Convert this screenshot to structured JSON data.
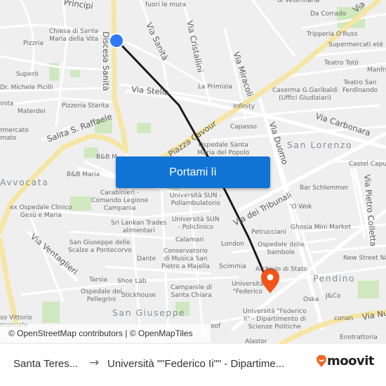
{
  "map": {
    "labels": {
      "principi": "Principi",
      "fuori_le_mura": "fuori le mura",
      "veterinaria": "di Veterinaria",
      "chiesa": "Chiesa di Santa\nMaria della Vita",
      "pizzeria": "Pizzria",
      "supero": "Superò",
      "picilli": "Dr. Michele Picilli",
      "costa": "osta",
      "materdei": "Materdei",
      "pizzeria_starita": "Pizzeria Starita",
      "supermercato": "rmercato\nmato",
      "da_corrado": "Da Corrado",
      "tripperia": "Tripperia O'Russ",
      "supermercati_ete": "Supermercati eté",
      "teatro_toto": "Teatro Totò",
      "manfredi": "Manfre",
      "teatro_san_ferdinando": "Teatro San\nFerdinando",
      "caserma": "Caserma G.Garibaldi\n(Uffici Giudiziari)",
      "la_primizia": "La Primizia",
      "infinity": "Infinity",
      "capasso": "Capasso",
      "ospedale_santa_maria": "Ospedale Santa\nMaria del Popolo",
      "bb_m": "B&B M",
      "bb_maria": "B&B Maria",
      "carabinieri": "Carabinieri -\nComando Legione\nCampania",
      "ex_ospedale": "ex Ospedale Clinico\nGesù e Maria",
      "sri_lankan": "Sri Lankan Trades\nalimentari",
      "univ_sun_poli": "Università SUN -\nPoliambulatorio",
      "univ_sun_policlinico": "Università SUN\n- Policlinico",
      "calamari": "Calamari",
      "castel_capuano": "Castel Capua",
      "bar_schlemmer": "Bar Schlemmer",
      "o_wok": "'O Wok",
      "ghosia": "Ghosia Mini Market",
      "petrucciani": "Petrucciani",
      "london": "London",
      "ospedale_bambole": "Ospedale delle\nbambole",
      "new_street": "New Street Nap",
      "archivio": "Archivio di Stato",
      "scimmia": "Scimmia",
      "univ_federico_short": "Università\n\"Federico",
      "univ_federico": "Università \"Federico\nII\" - Dipartimento di\nScienze Politiche",
      "oska": "Oska",
      "jco": "J&Co",
      "conan": "conan",
      "enotrattoria": "Enotrattoria",
      "alastor": "Alastor",
      "oof": "oof",
      "san_giuseppe_scalze": "San Giuseppe delle\nScalze a Pontecorvo",
      "dante": "Dante",
      "conservatorio": "Conservatorio\ndi Musica San\nPietro a Majella",
      "tarsia": "Tarsia",
      "shoe_lab": "Shoe Lab",
      "ospedale_pellegrini": "Ospedale dei\nPellegrini",
      "stickhouse": "Stickhouse",
      "campanile": "Campanile di\nSanta Chiara",
      "vittorio": "so Vittorio\nmanuele"
    },
    "streets": {
      "discesa_sanita": "Discesa Sanità",
      "via_sanita": "Via Sanità",
      "via_cristallini": "Via Cristallini",
      "via_miracoli": "Via Miracoli",
      "via_stella": "Via Stella",
      "salita_raffaele": "Salita S. Raffaele",
      "piazza_cavour": "Piazza Cavour",
      "via_carbonara": "Via Carbonara",
      "via_duomo": "Via Duomo",
      "via_tribunali": "Via dei Tribunali",
      "via_pietro_colletta": "Via Pietro Colletta",
      "via_ventaglieri": "Via Ventaglieri",
      "via_nuova": "Via Nu",
      "via_top": "Via"
    },
    "districts": {
      "avvocata": "Avvocata",
      "san_lorenzo": "San Lorenzo",
      "pendino": "Pendino",
      "san_giuseppe": "San Giuseppe"
    },
    "colors": {
      "route": "#1a1a1a",
      "origin": "#2f7bf5",
      "destination": "#f2541b",
      "major_road": "#f7e7a6",
      "park": "#c8e6b4"
    }
  },
  "cta": {
    "label": "Portami lì"
  },
  "attribution": "© OpenStreetMap contributors | © OpenMapTiles",
  "footer": {
    "from": "Santa Teres...",
    "arrow": "→",
    "to": "Università \"\"Federico Ii\"\" - Dipartime...",
    "brand": "moovit",
    "brand_color": "#f26522"
  }
}
